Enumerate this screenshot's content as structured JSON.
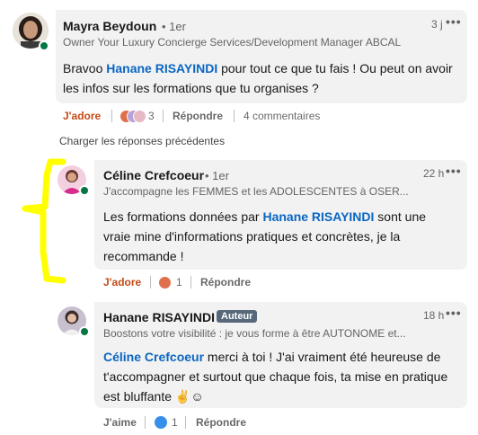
{
  "comments": [
    {
      "author": "Mayra Beydoun",
      "degree": "• 1er",
      "headline": "Owner Your Luxury Concierge Services/Development Manager ABCAL",
      "time": "3 j",
      "text_before": "Bravoo ",
      "mention": "Hanane RISAYINDI",
      "text_after": " pour tout ce que tu fais ! Ou peut on avoir les infos sur les formations que tu organises ?",
      "like_label": "J'adore",
      "reaction_count": "3",
      "reply_label": "Répondre",
      "comments_count": "4 commentaires"
    }
  ],
  "load_previous": "Charger les réponses précédentes",
  "replies": [
    {
      "author": "Céline Crefcoeur",
      "degree": "• 1er",
      "headline": "J'accompagne les FEMMES et les ADOLESCENTES à OSER...",
      "time": "22 h",
      "text_before": "Les formations données par ",
      "mention": "Hanane RISAYINDI",
      "text_after": " sont une vraie mine d'informations pratiques et concrètes, je la recommande !",
      "like_label": "J'adore",
      "reaction_count": "1",
      "reply_label": "Répondre"
    },
    {
      "author": "Hanane RISAYINDI",
      "badge": "Auteur",
      "headline": "Boostons votre visibilité : je vous forme à être AUTONOME et...",
      "time": "18 h",
      "mention": "Céline Crefcoeur",
      "text_after": " merci à toi ! J'ai vraiment été heureuse de t'accompagner et surtout que chaque fois, ta mise en pratique est bluffante ✌️☺",
      "like_label": "J'aime",
      "reaction_count": "1",
      "reply_label": "Répondre"
    }
  ],
  "colors": {
    "mention": "#0a66c2",
    "liked": "#c34a17",
    "bubble": "#f2f2f2",
    "annotation": "#ffff00"
  }
}
